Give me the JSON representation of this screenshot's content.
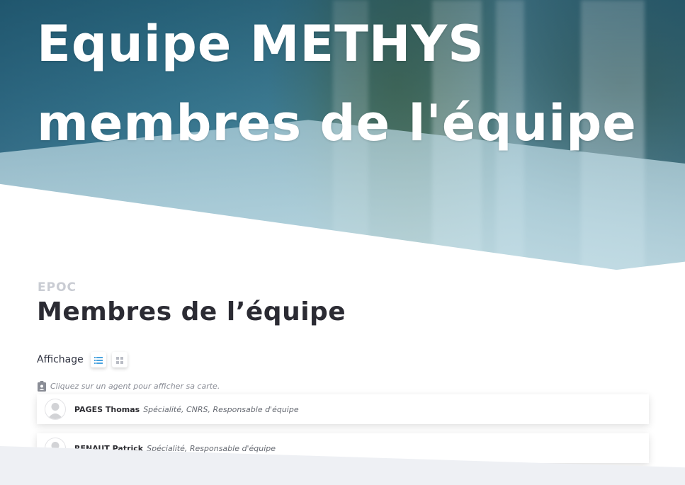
{
  "hero": {
    "title_line1": "Equipe METHYS",
    "title_line2": "membres de l'équipe"
  },
  "section": {
    "kicker": "EPOC",
    "title": "Membres de l’équipe"
  },
  "view_toggle": {
    "label": "Affichage",
    "options": [
      {
        "icon": "list-icon",
        "active": true
      },
      {
        "icon": "grid-icon",
        "active": false
      }
    ]
  },
  "hint": {
    "icon": "clipboard-badge-icon",
    "text": "Cliquez sur un agent pour afficher sa carte."
  },
  "members": [
    {
      "name": "PAGES Thomas",
      "role": "Spécialité, CNRS, Responsable d'équipe"
    },
    {
      "name": "RENAUT Patrick",
      "role": "Spécialité, Responsable d'équipe"
    }
  ],
  "colors": {
    "accent": "#4aa3df",
    "title": "#2b2b33",
    "kicker": "#c9ccd3"
  }
}
